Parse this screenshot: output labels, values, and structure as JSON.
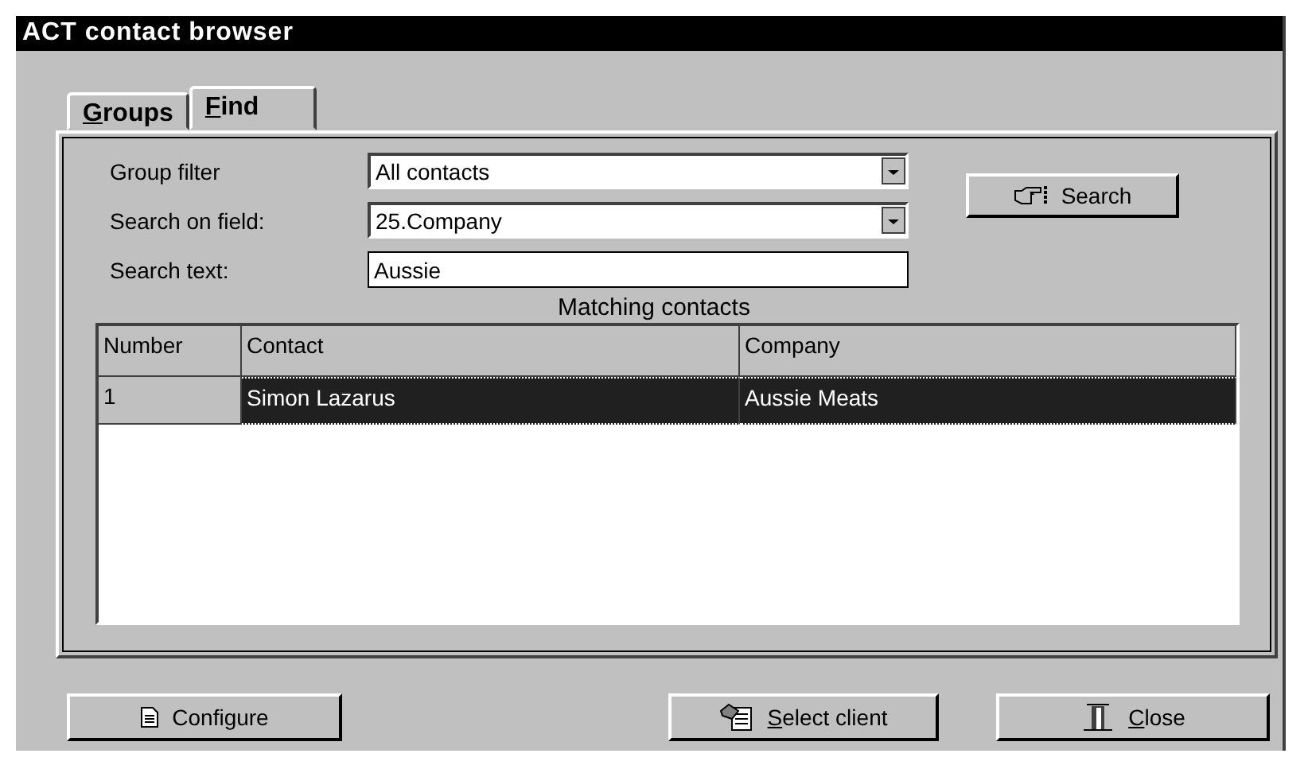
{
  "window": {
    "title": "ACT contact browser"
  },
  "tabs": [
    {
      "label": "Groups",
      "selected": false,
      "mnemonic": true
    },
    {
      "label": "Find",
      "selected": true,
      "mnemonic": true
    }
  ],
  "fields": [
    {
      "kind": "dropdown",
      "label": "Group filter",
      "value": "All contacts"
    },
    {
      "kind": "dropdown",
      "label": "Search on field:",
      "value": "25.Company"
    },
    {
      "kind": "text",
      "label": "Search text:",
      "value": "Aussie"
    }
  ],
  "search_button": {
    "label": "Search"
  },
  "results": {
    "title": "Matching contacts",
    "columns": [
      "Number",
      "Contact",
      "Company"
    ],
    "rows": [
      {
        "cells": [
          "1",
          "Simon Lazarus",
          "Aussie Meats"
        ],
        "selected": true
      }
    ]
  },
  "buttons": [
    {
      "label": "Configure",
      "mnemonic": false
    },
    {
      "label": "Select client",
      "mnemonic": true
    },
    {
      "label": "Close",
      "mnemonic": true
    }
  ]
}
